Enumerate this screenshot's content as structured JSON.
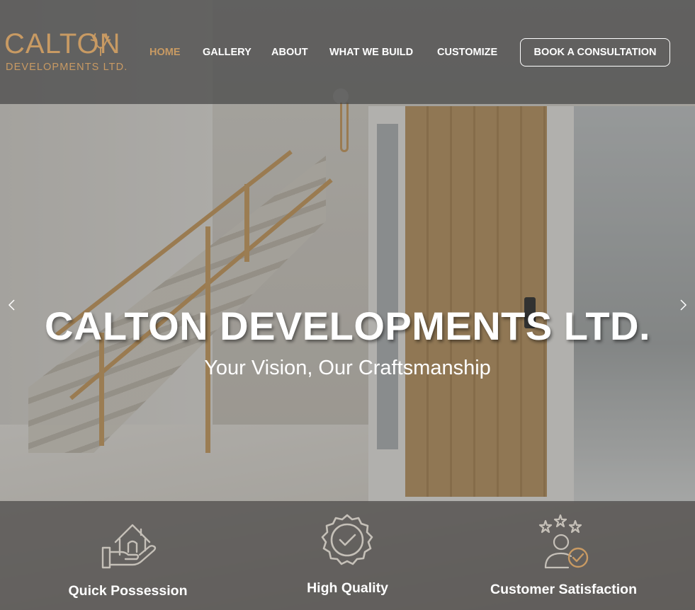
{
  "brand": {
    "name": "CALTON",
    "subtitle": "DEVELOPMENTS LTD.",
    "accent": "#c89a63"
  },
  "nav": {
    "items": [
      {
        "label": "HOME",
        "active": true
      },
      {
        "label": "GALLERY",
        "active": false
      },
      {
        "label": "ABOUT",
        "active": false
      },
      {
        "label": "WHAT WE BUILD",
        "active": false
      },
      {
        "label": "CUSTOMIZE",
        "active": false
      }
    ],
    "cta_label": "BOOK A CONSULTATION"
  },
  "hero": {
    "title": "CALTON DEVELOPMENTS LTD.",
    "subtitle": "Your Vision, Our Craftsmanship",
    "prev_icon": "chevron-left-icon",
    "next_icon": "chevron-right-icon"
  },
  "features": [
    {
      "label": "Quick Possession",
      "icon": "house-in-hand-icon"
    },
    {
      "label": "High Quality",
      "icon": "quality-badge-check-icon"
    },
    {
      "label": "Customer Satisfaction",
      "icon": "customer-stars-check-icon"
    }
  ],
  "colors": {
    "header_bg": "#464646",
    "text": "#ffffff",
    "icon_stroke": "#c5c0b8"
  }
}
